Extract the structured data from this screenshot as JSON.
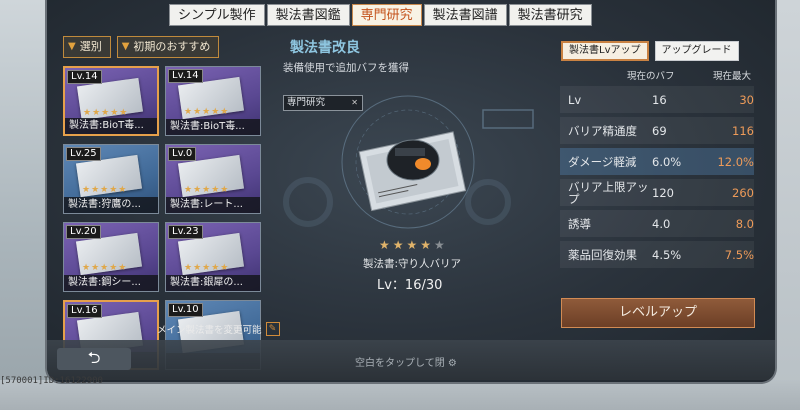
{
  "tabs": [
    "シンプル製作",
    "製法書図鑑",
    "専門研究",
    "製法書図譜",
    "製法書研究"
  ],
  "active_tab": "専門研究",
  "filters": {
    "select": "選別",
    "recommend": "初期のおすすめ"
  },
  "cards": [
    {
      "lv": "Lv.14",
      "name": "製法書:BioT毒...",
      "stars": "★★★★★",
      "style": "purple selected"
    },
    {
      "lv": "Lv.14",
      "name": "製法書:BioT毒...",
      "stars": "★★★★★",
      "style": "purple"
    },
    {
      "lv": "Lv.25",
      "name": "製法書:狩鷹の...",
      "stars": "★★★★★",
      "style": "blue"
    },
    {
      "lv": "Lv.0",
      "name": "製法書:レート...",
      "stars": "★★★★★",
      "style": "purple"
    },
    {
      "lv": "Lv.20",
      "name": "製法書:鋼シー...",
      "stars": "★★★★★",
      "style": "purple"
    },
    {
      "lv": "Lv.23",
      "name": "製法書:銀犀の...",
      "stars": "★★★★★",
      "style": "purple"
    },
    {
      "lv": "Lv.16",
      "name": "",
      "stars": "",
      "style": "purple selected"
    },
    {
      "lv": "Lv.10",
      "name": "",
      "stars": "",
      "style": "blue"
    }
  ],
  "change_note": "メイン製法書を変更可能",
  "center": {
    "title": "製法書改良",
    "subtitle": "装備使用で追加バフを獲得",
    "tag": "専門研究",
    "tag_close": "✕",
    "stars_on": "★★★★",
    "stars_off": "★",
    "item_name": "製法書:守り人バリア",
    "level": "Lv：16/30"
  },
  "right": {
    "tab_levelup": "製法書Lvアップ",
    "tab_upgrade": "アップグレード",
    "head_current": "現在のバフ",
    "head_max": "現在最大",
    "stats": [
      {
        "label": "Lv",
        "cur": "16",
        "max": "30",
        "hl": false
      },
      {
        "label": "バリア精通度",
        "cur": "69",
        "max": "116",
        "hl": false
      },
      {
        "label": "ダメージ軽減",
        "cur": "6.0%",
        "max": "12.0%",
        "hl": true
      },
      {
        "label": "バリア上限アップ",
        "cur": "120",
        "max": "260",
        "hl": false
      },
      {
        "label": "誘導",
        "cur": "4.0",
        "max": "8.0",
        "hl": false
      },
      {
        "label": "薬品回復効果",
        "cur": "4.5%",
        "max": "7.5%",
        "hl": false
      }
    ],
    "levelup_button": "レベルアップ"
  },
  "bottom": {
    "back_symbol": "⮌",
    "tap_close": "空白をタップして閉"
  },
  "footer_id": "[570001]ID:16122900"
}
